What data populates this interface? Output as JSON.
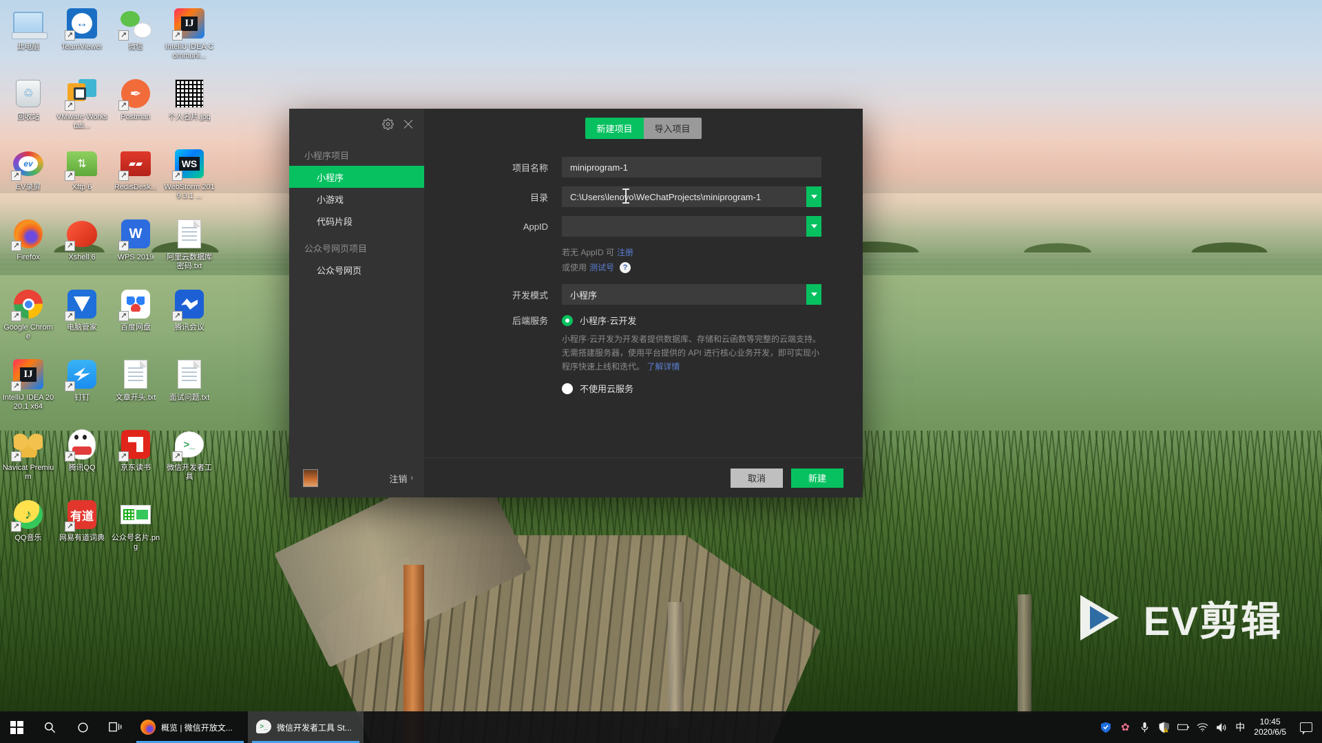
{
  "desktop": {
    "icons": [
      {
        "label": "此电脑",
        "icon": "this-pc-icon"
      },
      {
        "label": "TeamViewer",
        "icon": "teamviewer-icon"
      },
      {
        "label": "微信",
        "icon": "wechat-icon"
      },
      {
        "label": "IntelliJ IDEA Communi...",
        "icon": "intellij-idea-community-icon"
      },
      {
        "label": "回收站",
        "icon": "recycle-bin-icon"
      },
      {
        "label": "VMware Workstati...",
        "icon": "vmware-workstation-icon"
      },
      {
        "label": "Postman",
        "icon": "postman-icon"
      },
      {
        "label": "个人名片.jpg",
        "icon": "image-file-icon"
      },
      {
        "label": "EV录屏",
        "icon": "ev-recorder-icon"
      },
      {
        "label": "Xftp 6",
        "icon": "xftp-icon"
      },
      {
        "label": "RedisDesk...",
        "icon": "redis-desktop-manager-icon"
      },
      {
        "label": "WebStorm 2019.3.1 ...",
        "icon": "webstorm-icon"
      },
      {
        "label": "Firefox",
        "icon": "firefox-icon"
      },
      {
        "label": "Xshell 6",
        "icon": "xshell-icon"
      },
      {
        "label": "WPS 2019",
        "icon": "wps-office-icon"
      },
      {
        "label": "阿里云数据库密码.txt",
        "icon": "text-file-icon"
      },
      {
        "label": "Google Chrome",
        "icon": "chrome-icon"
      },
      {
        "label": "电脑管家",
        "icon": "tencent-pc-manager-icon"
      },
      {
        "label": "百度网盘",
        "icon": "baidu-netdisk-icon"
      },
      {
        "label": "腾讯会议",
        "icon": "tencent-meeting-icon"
      },
      {
        "label": "IntelliJ IDEA 2020.1 x64",
        "icon": "intellij-idea-icon"
      },
      {
        "label": "钉钉",
        "icon": "dingtalk-icon"
      },
      {
        "label": "文章开头.txt",
        "icon": "text-file-icon"
      },
      {
        "label": "面试问题.txt",
        "icon": "text-file-icon"
      },
      {
        "label": "Navicat Premium",
        "icon": "navicat-premium-icon"
      },
      {
        "label": "腾讯QQ",
        "icon": "tencent-qq-icon"
      },
      {
        "label": "京东读书",
        "icon": "jd-read-icon"
      },
      {
        "label": "微信开发者工具",
        "icon": "wechat-devtools-icon"
      },
      {
        "label": "QQ音乐",
        "icon": "qq-music-icon"
      },
      {
        "label": "网易有道词典",
        "icon": "youdao-dict-icon"
      },
      {
        "label": "公众号名片.png",
        "icon": "image-file-icon"
      }
    ]
  },
  "dialog": {
    "titlebar": {
      "settings_icon": "gear-icon",
      "close_icon": "close-icon"
    },
    "sidebar": {
      "section_miniprogram": "小程序项目",
      "items": [
        {
          "label": "小程序",
          "active": true
        },
        {
          "label": "小游戏",
          "active": false
        },
        {
          "label": "代码片段",
          "active": false
        }
      ],
      "section_official": "公众号网页项目",
      "items2": [
        {
          "label": "公众号网页",
          "active": false
        }
      ],
      "logout_label": "注销",
      "logout_chevron": "›"
    },
    "tabs": [
      {
        "label": "新建项目",
        "active": true
      },
      {
        "label": "导入项目",
        "active": false
      }
    ],
    "form": {
      "project_name_label": "项目名称",
      "project_name_value": "miniprogram-1",
      "project_name_placeholder": "",
      "directory_label": "目录",
      "directory_value": "C:\\Users\\lenovo\\WeChatProjects\\miniprogram-1",
      "directory_placeholder": "",
      "appid_label": "AppID",
      "appid_value": "",
      "appid_placeholder": "",
      "hint_line1_pre": "若无 AppID 可 ",
      "hint_line1_link": "注册",
      "hint_line2_pre": "或使用 ",
      "hint_line2_link": "测试号",
      "hint_help_icon": "question-mark-icon",
      "hint_help_label": "?",
      "dev_mode_label": "开发模式",
      "dev_mode_value": "小程序",
      "backend_label": "后端服务",
      "backend_options": [
        {
          "label": "小程序·云开发",
          "selected": true
        },
        {
          "label": "不使用云服务",
          "selected": false
        }
      ],
      "backend_description": "小程序·云开发为开发者提供数据库、存储和云函数等完整的云端支持。无需搭建服务器，使用平台提供的 API 进行核心业务开发，即可实现小程序快速上线和迭代。",
      "backend_description_link": "了解详情"
    },
    "footer": {
      "cancel_label": "取消",
      "confirm_label": "新建"
    },
    "accent_color": "#07c160"
  },
  "watermark": {
    "text": "EV剪辑",
    "play_icon": "play-triangle-icon"
  },
  "taskbar": {
    "start_icon": "windows-start-icon",
    "search_icon": "search-icon",
    "cortana_icon": "cortana-circle-icon",
    "task_view_icon": "task-view-icon",
    "tasks": [
      {
        "label": "概览 | 微信开放文...",
        "icon": "firefox-icon",
        "active": false
      },
      {
        "label": "微信开发者工具 St...",
        "icon": "wechat-devtools-icon",
        "active": true
      }
    ],
    "tray": [
      {
        "icon": "tencent-pc-manager-tray-icon",
        "label": ""
      },
      {
        "icon": "flower-tray-icon",
        "label": ""
      },
      {
        "icon": "microphone-tray-icon",
        "label": ""
      },
      {
        "icon": "security-warning-tray-icon",
        "label": ""
      },
      {
        "icon": "battery-tray-icon",
        "label": ""
      },
      {
        "icon": "wifi-tray-icon",
        "label": ""
      },
      {
        "icon": "volume-tray-icon",
        "label": ""
      },
      {
        "icon": "ime-chinese-tray-icon",
        "label": "中"
      }
    ],
    "clock_time": "10:45",
    "clock_date": "2020/6/5",
    "action_center_icon": "action-center-icon"
  }
}
